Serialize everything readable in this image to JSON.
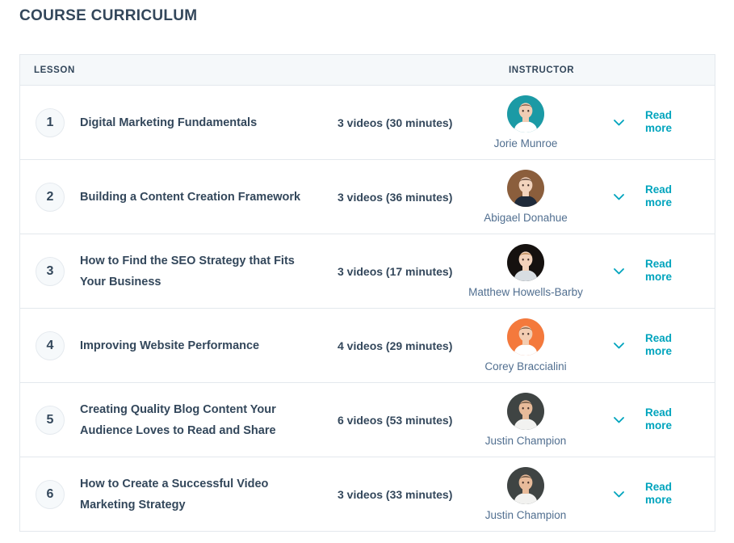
{
  "page": {
    "title": "COURSE CURRICULUM"
  },
  "table": {
    "columns": {
      "lesson": "LESSON",
      "instructor": "INSTRUCTOR"
    },
    "read_more_label": "Read more",
    "chevron_icon": "chevron-down-icon",
    "accent_color": "#00a4bd",
    "heading_color": "#33475b",
    "header_bg": "#f5f8fa",
    "border_color": "#e3e8ed",
    "rows": [
      {
        "number": "1",
        "title": "Digital Marketing Fundamentals",
        "videos": "3 videos (30 minutes)",
        "instructor": "Jorie Munroe",
        "avatar_bg": "#1b9aa5",
        "avatar_skin": "#f0cdb4",
        "avatar_hair": "#6b4733",
        "avatar_shirt": "#ffffff"
      },
      {
        "number": "2",
        "title": "Building a Content Creation Framework",
        "videos": "3 videos (36 minutes)",
        "instructor": "Abigael Donahue",
        "avatar_bg": "#8b5e3c",
        "avatar_skin": "#f2d3bd",
        "avatar_hair": "#3a2318",
        "avatar_shirt": "#1f2a3a"
      },
      {
        "number": "3",
        "title": "How to Find the SEO Strategy that Fits Your Business",
        "videos": "3 videos (17 minutes)",
        "instructor": "Matthew Howells-Barby",
        "avatar_bg": "#15110f",
        "avatar_skin": "#f3d2bb",
        "avatar_hair": "#b0793f",
        "avatar_shirt": "#d8dde2"
      },
      {
        "number": "4",
        "title": "Improving Website Performance",
        "videos": "4 videos (29 minutes)",
        "instructor": "Corey Braccialini",
        "avatar_bg": "#f4793c",
        "avatar_skin": "#f3cdb2",
        "avatar_hair": "#6a4a33",
        "avatar_shirt": "#ffffff"
      },
      {
        "number": "5",
        "title": "Creating Quality Blog Content Your Audience Loves to Read and Share",
        "videos": "6 videos (53 minutes)",
        "instructor": "Justin Champion",
        "avatar_bg": "#3f4443",
        "avatar_skin": "#e8bb9a",
        "avatar_hair": "#4b3a2a",
        "avatar_shirt": "#f2f2f0"
      },
      {
        "number": "6",
        "title": "How to Create a Successful Video Marketing Strategy",
        "videos": "3 videos (33 minutes)",
        "instructor": "Justin Champion",
        "avatar_bg": "#3f4443",
        "avatar_skin": "#e8bb9a",
        "avatar_hair": "#4b3a2a",
        "avatar_shirt": "#f2f2f0"
      }
    ]
  }
}
